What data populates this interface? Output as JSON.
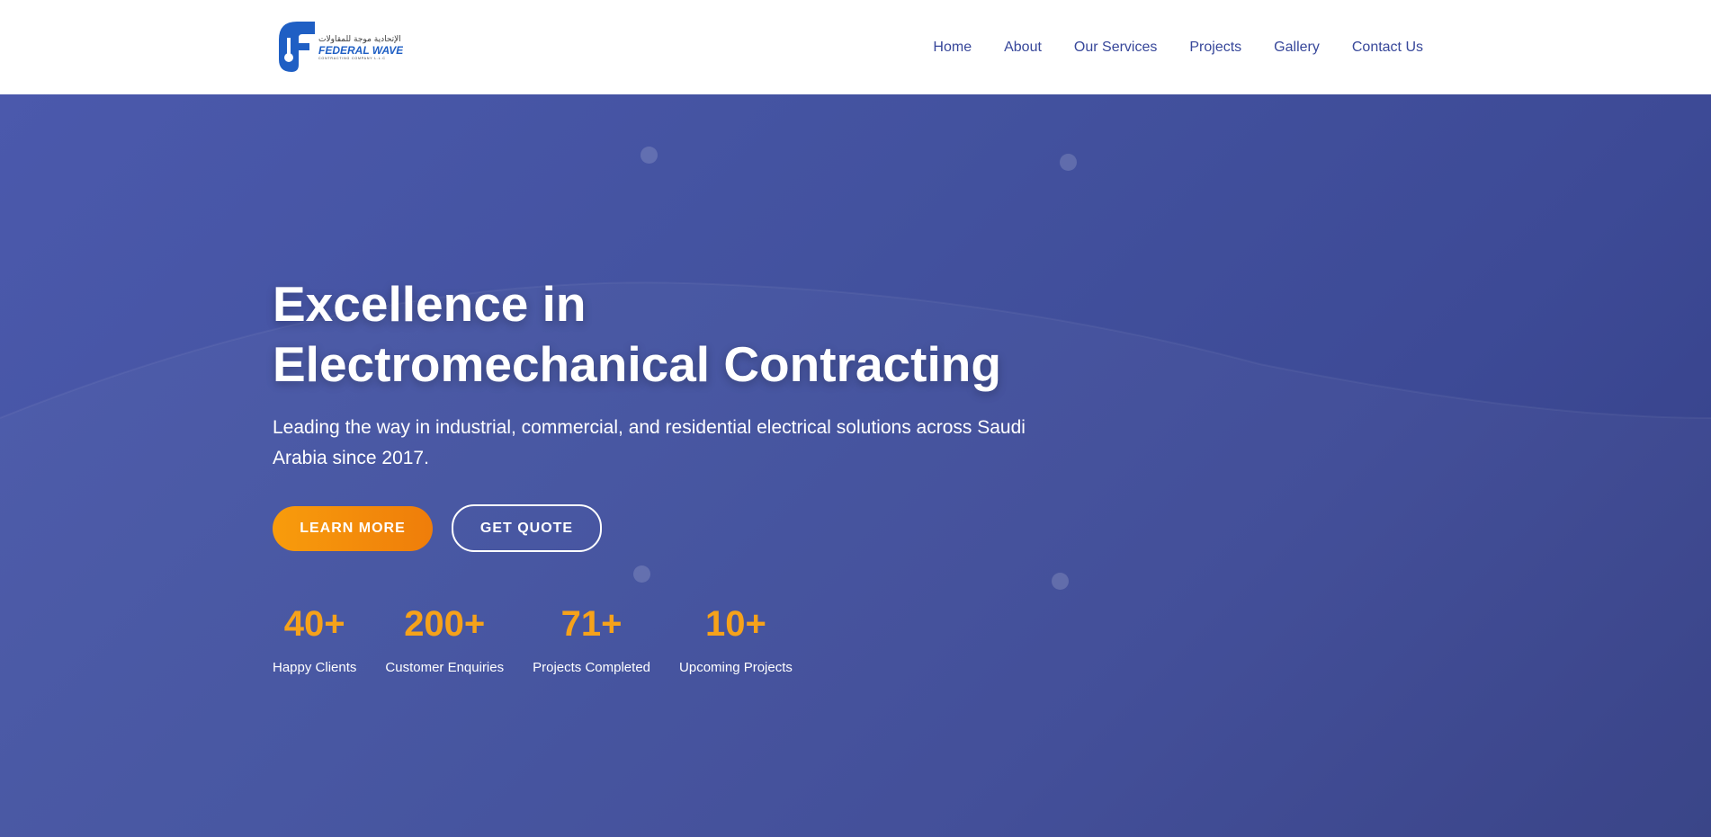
{
  "brand": {
    "name": "FEDERAL WAVE",
    "name_ar": "شركة الإتحادية موجة للمقاولات",
    "tagline": "CONTRACTING COMPANY L.L.C",
    "logo_color": "#1f5fc4"
  },
  "nav": {
    "items": [
      {
        "label": "Home"
      },
      {
        "label": "About"
      },
      {
        "label": "Our Services"
      },
      {
        "label": "Projects"
      },
      {
        "label": "Gallery"
      },
      {
        "label": "Contact Us"
      }
    ]
  },
  "hero": {
    "title_line1": "Excellence in",
    "title_line2": "Electromechanical Contracting",
    "subtitle": "Leading the way in industrial, commercial, and residential electrical solutions across Saudi Arabia since 2017.",
    "learn_more": "LEARN MORE",
    "get_quote": "GET QUOTE"
  },
  "stats": [
    {
      "value": "40+",
      "label": "Happy Clients"
    },
    {
      "value": "200+",
      "label": "Customer Enquiries"
    },
    {
      "value": "71+",
      "label": "Projects Completed"
    },
    {
      "value": "10+",
      "label": "Upcoming Projects"
    }
  ],
  "colors": {
    "nav_text": "#37479a",
    "hero_bg": "#4352a0",
    "accent_orange": "#f6a21a",
    "button_orange": "#f89c0c"
  }
}
